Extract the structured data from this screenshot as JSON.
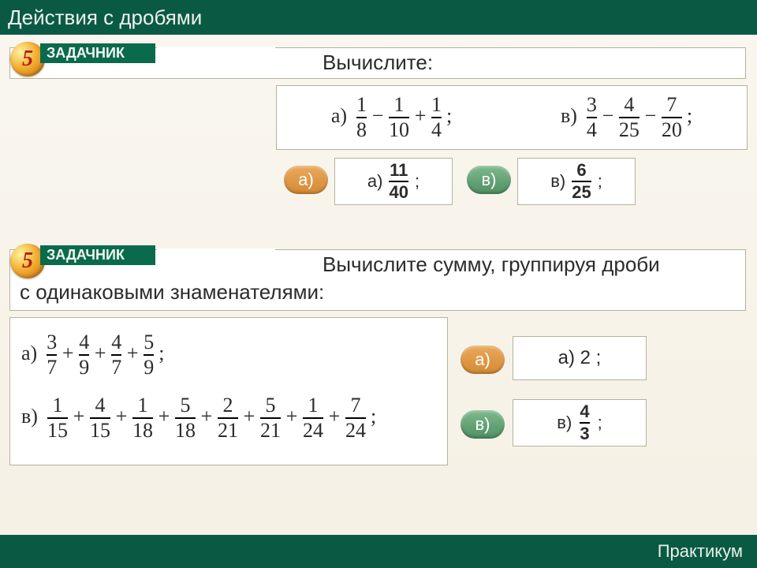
{
  "title": "Действия с дробями",
  "footer": "Практикум",
  "badge_number": "5",
  "badge_label": "ЗАДАЧНИК",
  "problem1": {
    "title_line": "Вычислите:",
    "expr_a": {
      "prefix": "а)",
      "terms": [
        {
          "num": "1",
          "den": "8"
        },
        {
          "op": "−",
          "num": "1",
          "den": "10"
        },
        {
          "op": "+",
          "num": "1",
          "den": "4"
        }
      ],
      "tail": ";"
    },
    "expr_v": {
      "prefix": "в)",
      "terms": [
        {
          "num": "3",
          "den": "4"
        },
        {
          "op": "−",
          "num": "4",
          "den": "25"
        },
        {
          "op": "−",
          "num": "7",
          "den": "20"
        }
      ],
      "tail": ";"
    },
    "pill_a": "а)",
    "pill_v": "в)",
    "ans_a": {
      "prefix": "а)",
      "num": "11",
      "den": "40",
      "tail": ";"
    },
    "ans_v": {
      "prefix": "в)",
      "num": "6",
      "den": "25",
      "tail": ";"
    }
  },
  "problem2": {
    "title_line1": "Вычислите сумму, группируя дроби",
    "title_line2": "с одинаковыми знаменателями:",
    "expr_a": {
      "prefix": "а)",
      "terms": [
        {
          "num": "3",
          "den": "7"
        },
        {
          "op": "+",
          "num": "4",
          "den": "9"
        },
        {
          "op": "+",
          "num": "4",
          "den": "7"
        },
        {
          "op": "+",
          "num": "5",
          "den": "9"
        }
      ],
      "tail": ";"
    },
    "expr_v": {
      "prefix": "в)",
      "terms": [
        {
          "num": "1",
          "den": "15"
        },
        {
          "op": "+",
          "num": "4",
          "den": "15"
        },
        {
          "op": "+",
          "num": "1",
          "den": "18"
        },
        {
          "op": "+",
          "num": "5",
          "den": "18"
        },
        {
          "op": "+",
          "num": "2",
          "den": "21"
        },
        {
          "op": "+",
          "num": "5",
          "den": "21"
        },
        {
          "op": "+",
          "num": "1",
          "den": "24"
        },
        {
          "op": "+",
          "num": "7",
          "den": "24"
        }
      ],
      "tail": ";"
    },
    "pill_a": "а)",
    "pill_v": "в)",
    "ans_a_text": "а)  2 ;",
    "ans_v": {
      "prefix": "в)",
      "num": "4",
      "den": "3",
      "tail": ";"
    }
  }
}
